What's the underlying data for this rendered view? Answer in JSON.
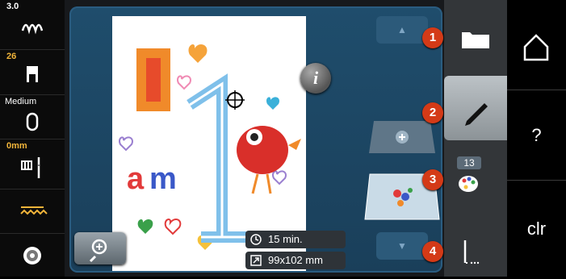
{
  "status_bar": {
    "stitch_length": "3.0",
    "presser_foot_number": "26",
    "tension_label": "Medium",
    "needle_position": "0mm"
  },
  "editor": {
    "stitch_time": "15 min.",
    "design_size": "99x102 mm"
  },
  "function_bar": {
    "items": [
      {
        "badge": "1",
        "icon": "folder-icon"
      },
      {
        "badge": "2",
        "icon": "pencil-icon"
      },
      {
        "badge": "3",
        "icon": "color-palette-icon",
        "count": "13"
      },
      {
        "badge": "4",
        "icon": "needle-thread-icon"
      }
    ]
  },
  "system_bar": {
    "clear_label": "clr",
    "help_label": "?"
  },
  "colors": {
    "accent": "#d43a17",
    "panel": "#1f4d6c",
    "status_amber": "#f2b53a"
  }
}
